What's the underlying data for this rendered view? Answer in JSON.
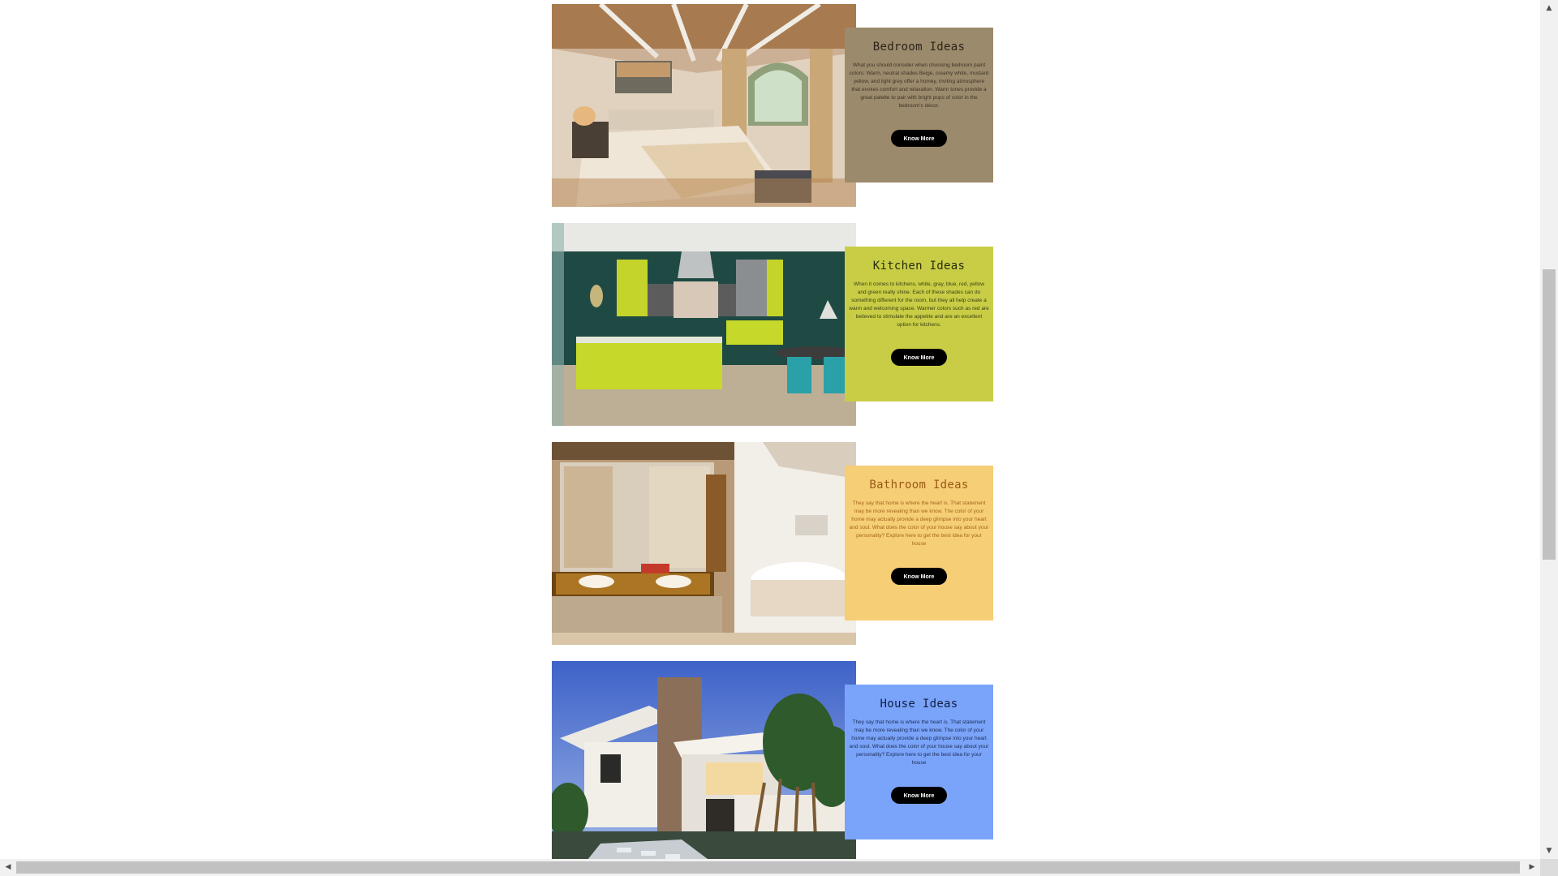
{
  "cards": [
    {
      "title": "Bedroom Ideas",
      "body": "What you should consider when choosing bedroom paint colors: Warm, neutral shades Beige, creamy white, mustard yellow, and light grey offer a homey, inviting atmosphere that evokes comfort and relaxation. Warm tones provide a great palette to pair with bright pops of color in the bedroom's décor.",
      "button": "Know More",
      "image": "bedroom-photo"
    },
    {
      "title": "Kitchen Ideas",
      "body": "When it comes to kitchens, white, gray, blue, red, yellow and green really shine. Each of these shades can do something different for the room, but they all help create a warm and welcoming space. Warmer colors such as red are believed to stimulate the appetite and are an excellent option for kitchens.",
      "button": "Know More",
      "image": "kitchen-photo"
    },
    {
      "title": "Bathroom Ideas",
      "body": "They say that home is where the heart is. That statement may be more revealing than we know. The color of your home may actually provide a deep glimpse into your heart and soul. What does the color of your house say about your personality? Explore here to get the best idea for your house",
      "button": "Know More",
      "image": "bathroom-photo"
    },
    {
      "title": "House Ideas",
      "body": "They say that home is where the heart is. That statement may be more revealing than we know. The color of your home may actually provide a deep glimpse into your heart and soul. What does the color of your house say about your personality? Explore here to get the best idea for your house",
      "button": "Know More",
      "image": "house-photo"
    }
  ],
  "colors": {
    "bedroom_panel": "#9c8a6c",
    "kitchen_panel": "#c8cd45",
    "bathroom_panel": "#f6ce76",
    "house_panel": "#7aa4f9",
    "button_bg": "#000000"
  },
  "scrollbars": {
    "up_icon": "arrow-up-icon",
    "down_icon": "arrow-down-icon",
    "left_icon": "arrow-left-icon",
    "right_icon": "arrow-right-icon"
  }
}
